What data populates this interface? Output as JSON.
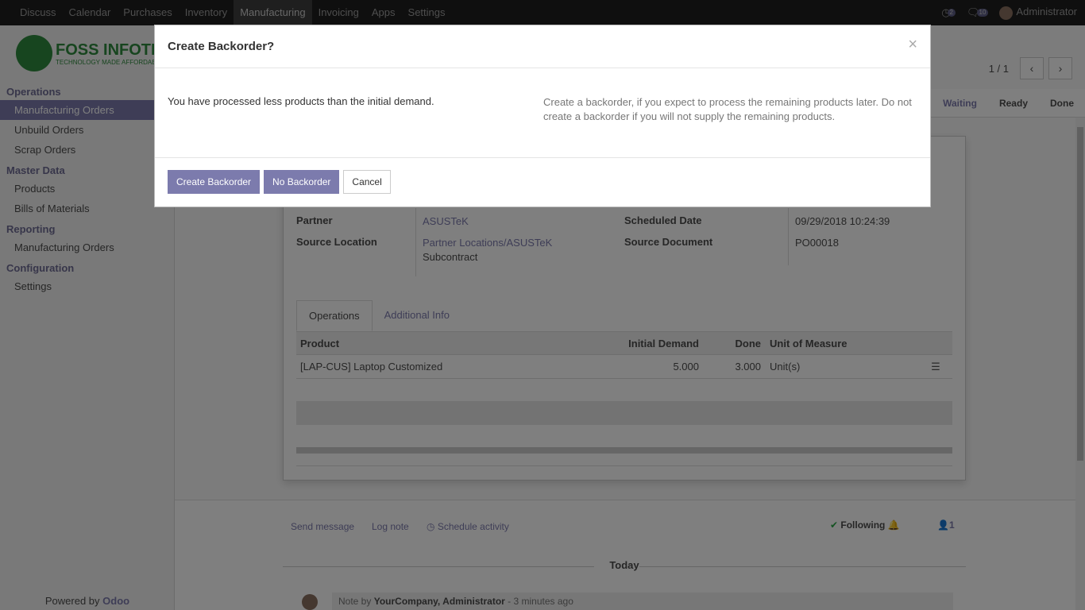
{
  "topnav": {
    "items": [
      "Discuss",
      "Calendar",
      "Purchases",
      "Inventory",
      "Manufacturing",
      "Invoicing",
      "Apps",
      "Settings"
    ],
    "activity_count": "2",
    "message_count": "10",
    "user": "Administrator"
  },
  "logo": {
    "name": "FOSS INFOTECH",
    "tagline": "TECHNOLOGY MADE AFFORDABLE"
  },
  "sidebar": {
    "operations_title": "Operations",
    "operations": [
      "Manufacturing Orders",
      "Unbuild Orders",
      "Scrap Orders"
    ],
    "master_title": "Master Data",
    "master": [
      "Products",
      "Bills of Materials"
    ],
    "reporting_title": "Reporting",
    "reporting": [
      "Manufacturing Orders"
    ],
    "config_title": "Configuration",
    "config": [
      "Settings"
    ],
    "powered_prefix": "Powered by",
    "powered_brand": "Odoo"
  },
  "pager": {
    "value": "1 / 1"
  },
  "statusbar": [
    "Waiting",
    "Ready",
    "Done"
  ],
  "form": {
    "partner_label": "Partner",
    "partner": "ASUSTeK",
    "source_location_label": "Source Location",
    "source_location_line1": "Partner Locations/ASUSTeK",
    "source_location_line2": "Subcontract",
    "scheduled_label": "Scheduled Date",
    "scheduled": "09/29/2018 10:24:39",
    "source_doc_label": "Source Document",
    "source_doc": "PO00018"
  },
  "tabs": [
    "Operations",
    "Additional Info"
  ],
  "table": {
    "headers": [
      "Product",
      "Initial Demand",
      "Done",
      "Unit of Measure"
    ],
    "rows": [
      {
        "product": "[LAP-CUS] Laptop Customized",
        "demand": "5.000",
        "done": "3.000",
        "uom": "Unit(s)"
      }
    ]
  },
  "chatter": {
    "send_message": "Send message",
    "log_note": "Log note",
    "schedule_activity": "Schedule activity",
    "following": "Following",
    "followers": "1",
    "today": "Today",
    "note_prefix": "Note by",
    "note_author": "YourCompany, Administrator",
    "note_time": "- 3 minutes ago"
  },
  "modal": {
    "title": "Create Backorder?",
    "message_left": "You have processed less products than the initial demand.",
    "message_right": "Create a backorder, if you expect to process the remaining products later. Do not create a backorder if you will not supply the remaining products.",
    "btn_create": "Create Backorder",
    "btn_no": "No Backorder",
    "btn_cancel": "Cancel",
    "close_symbol": "×"
  },
  "colors": {
    "brand": "#7c7bad",
    "topbar": "#1f1f1f",
    "logo_green": "#2f8b3e"
  }
}
